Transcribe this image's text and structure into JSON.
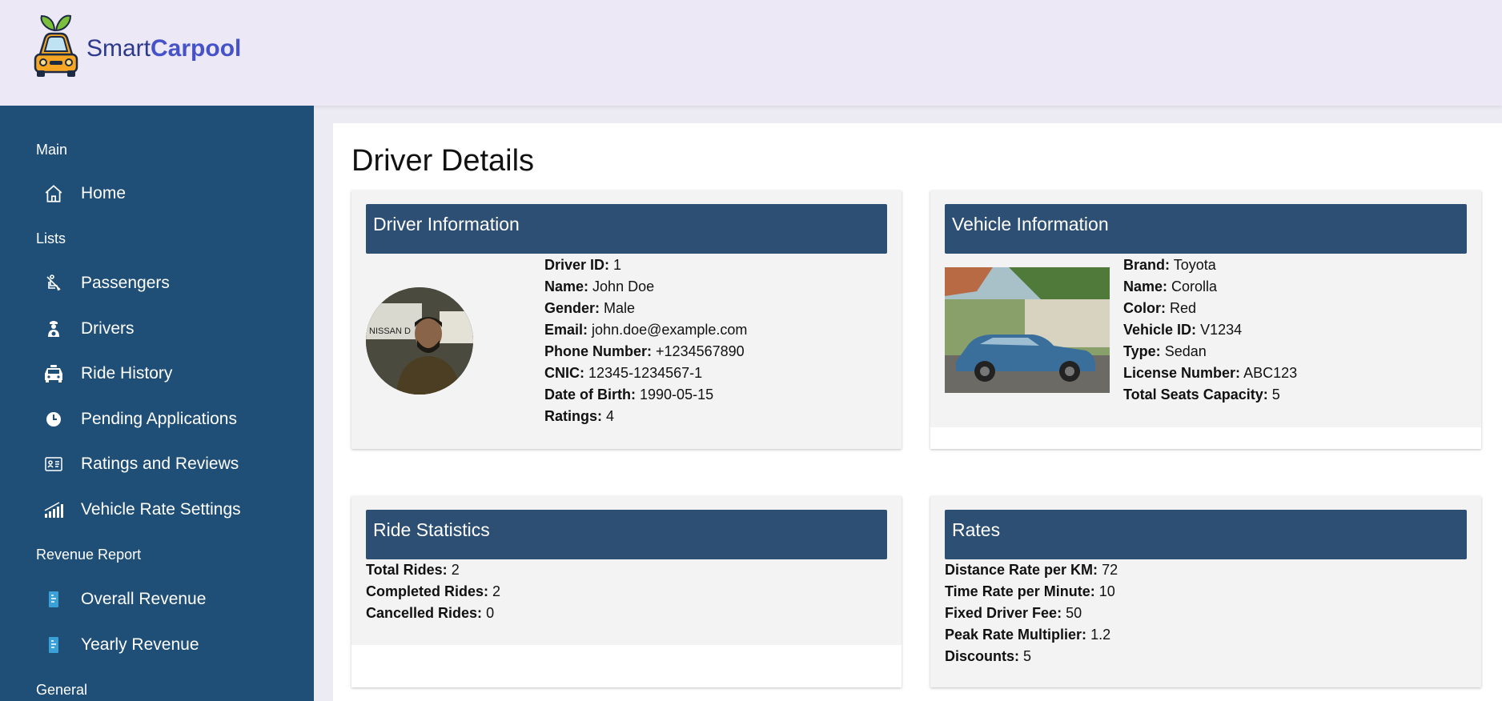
{
  "brand": {
    "name_part1": "Smart",
    "name_part2": "Carpool"
  },
  "sidebar": {
    "sections": [
      {
        "label": "Main"
      },
      {
        "label": "Lists"
      },
      {
        "label": "Revenue Report"
      },
      {
        "label": "General"
      }
    ],
    "items": [
      {
        "label": "Home",
        "icon": "home-icon"
      },
      {
        "label": "Passengers",
        "icon": "passenger-seat-icon"
      },
      {
        "label": "Drivers",
        "icon": "driver-icon"
      },
      {
        "label": "Ride History",
        "icon": "car-icon"
      },
      {
        "label": "Pending Applications",
        "icon": "clock-icon"
      },
      {
        "label": "Ratings and Reviews",
        "icon": "review-card-icon"
      },
      {
        "label": "Vehicle Rate Settings",
        "icon": "rate-chart-icon"
      },
      {
        "label": "Overall Revenue",
        "icon": "receipt-icon"
      },
      {
        "label": "Yearly Revenue",
        "icon": "receipt-icon"
      }
    ]
  },
  "page": {
    "title": "Driver Details"
  },
  "driver": {
    "heading": "Driver Information",
    "fields": [
      {
        "label": "Driver ID:",
        "value": "1"
      },
      {
        "label": "Name:",
        "value": "John Doe"
      },
      {
        "label": "Gender:",
        "value": "Male"
      },
      {
        "label": "Email:",
        "value": "john.doe@example.com"
      },
      {
        "label": "Phone Number:",
        "value": "+1234567890"
      },
      {
        "label": "CNIC:",
        "value": "12345-1234567-1"
      },
      {
        "label": "Date of Birth:",
        "value": "1990-05-15"
      },
      {
        "label": "Ratings:",
        "value": "4"
      }
    ]
  },
  "vehicle": {
    "heading": "Vehicle Information",
    "fields": [
      {
        "label": "Brand:",
        "value": "Toyota"
      },
      {
        "label": "Name:",
        "value": "Corolla"
      },
      {
        "label": "Color:",
        "value": "Red"
      },
      {
        "label": "Vehicle ID:",
        "value": "V1234"
      },
      {
        "label": "Type:",
        "value": "Sedan"
      },
      {
        "label": "License Number:",
        "value": "ABC123"
      },
      {
        "label": "Total Seats Capacity:",
        "value": "5"
      }
    ]
  },
  "stats": {
    "heading": "Ride Statistics",
    "fields": [
      {
        "label": "Total Rides:",
        "value": "2"
      },
      {
        "label": "Completed Rides:",
        "value": "2"
      },
      {
        "label": "Cancelled Rides:",
        "value": "0"
      }
    ]
  },
  "rates": {
    "heading": "Rates",
    "fields": [
      {
        "label": "Distance Rate per KM:",
        "value": "72"
      },
      {
        "label": "Time Rate per Minute:",
        "value": "10"
      },
      {
        "label": "Fixed Driver Fee:",
        "value": "50"
      },
      {
        "label": "Peak Rate Multiplier:",
        "value": "1.2"
      },
      {
        "label": "Discounts:",
        "value": "5"
      }
    ]
  },
  "colors": {
    "sidebar_bg": "#1f4e77",
    "header_bg": "#ece8f6",
    "card_heading_bg": "#2e4f74"
  }
}
